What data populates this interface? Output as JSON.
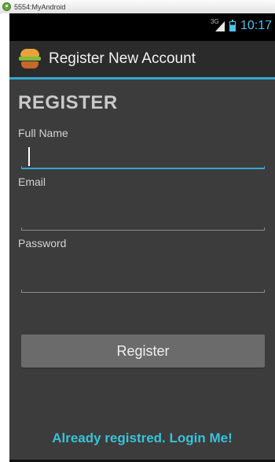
{
  "host_window": {
    "title": "5554:MyAndroid"
  },
  "statusbar": {
    "network_type": "3G",
    "time": "10:17",
    "icons": [
      "signal-icon",
      "battery-icon"
    ]
  },
  "actionbar": {
    "icon": "app-logo-icon",
    "title": "Register New Account",
    "divider_color": "#33a7cf"
  },
  "form": {
    "heading": "REGISTER",
    "fields": [
      {
        "label": "Full Name",
        "value": "",
        "focused": true
      },
      {
        "label": "Email",
        "value": ""
      },
      {
        "label": "Password",
        "value": ""
      }
    ],
    "submit_label": "Register",
    "login_link": "Already registred. Login Me!"
  },
  "colors": {
    "accent": "#33a7cf",
    "link": "#36c3d9",
    "background": "#3c3c3c",
    "button": "#6b6b6b"
  }
}
